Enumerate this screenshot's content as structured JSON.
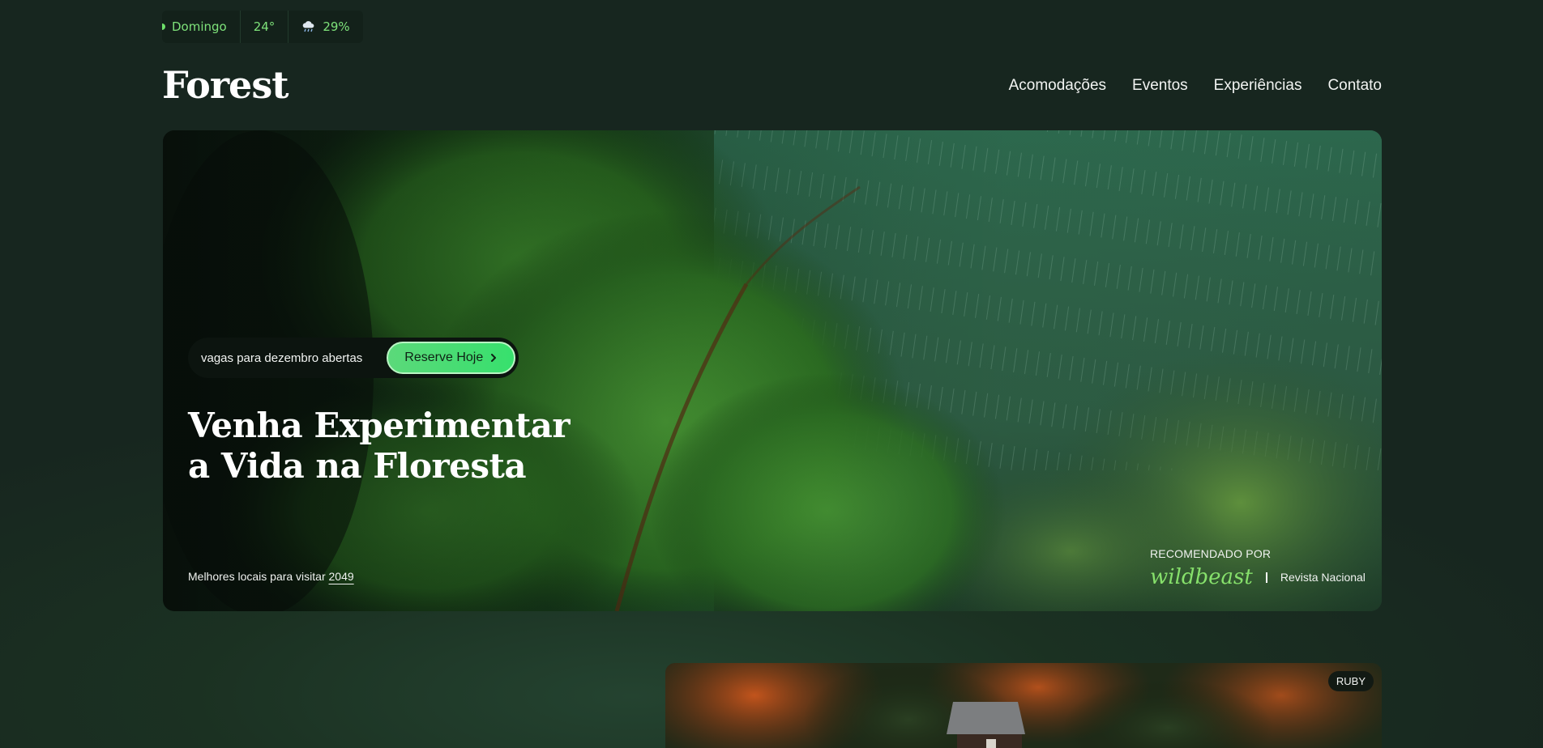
{
  "weather": {
    "day": "Domingo",
    "temperature": "24°",
    "rain_icon": "cloud-rain-icon",
    "rain_chance": "29%"
  },
  "header": {
    "logo": "Forest",
    "nav": [
      "Acomodações",
      "Eventos",
      "Experiências",
      "Contato"
    ]
  },
  "hero": {
    "badge_text": "vagas para dezembro abertas",
    "cta_label": "Reserve Hoje",
    "title_line1": "Venha Experimentar",
    "title_line2": "a Vida na Floresta",
    "best_places": "Melhores locais para visitar",
    "best_year": "2049",
    "recommended_label": "RECOMENDADO POR",
    "brand_1": "wildbeast",
    "brand_2": "Revista Nacional"
  },
  "card": {
    "tag": "RUBY"
  },
  "colors": {
    "background": "#17261f",
    "accent": "#5bd97a",
    "accent_text": "#86e06b"
  }
}
